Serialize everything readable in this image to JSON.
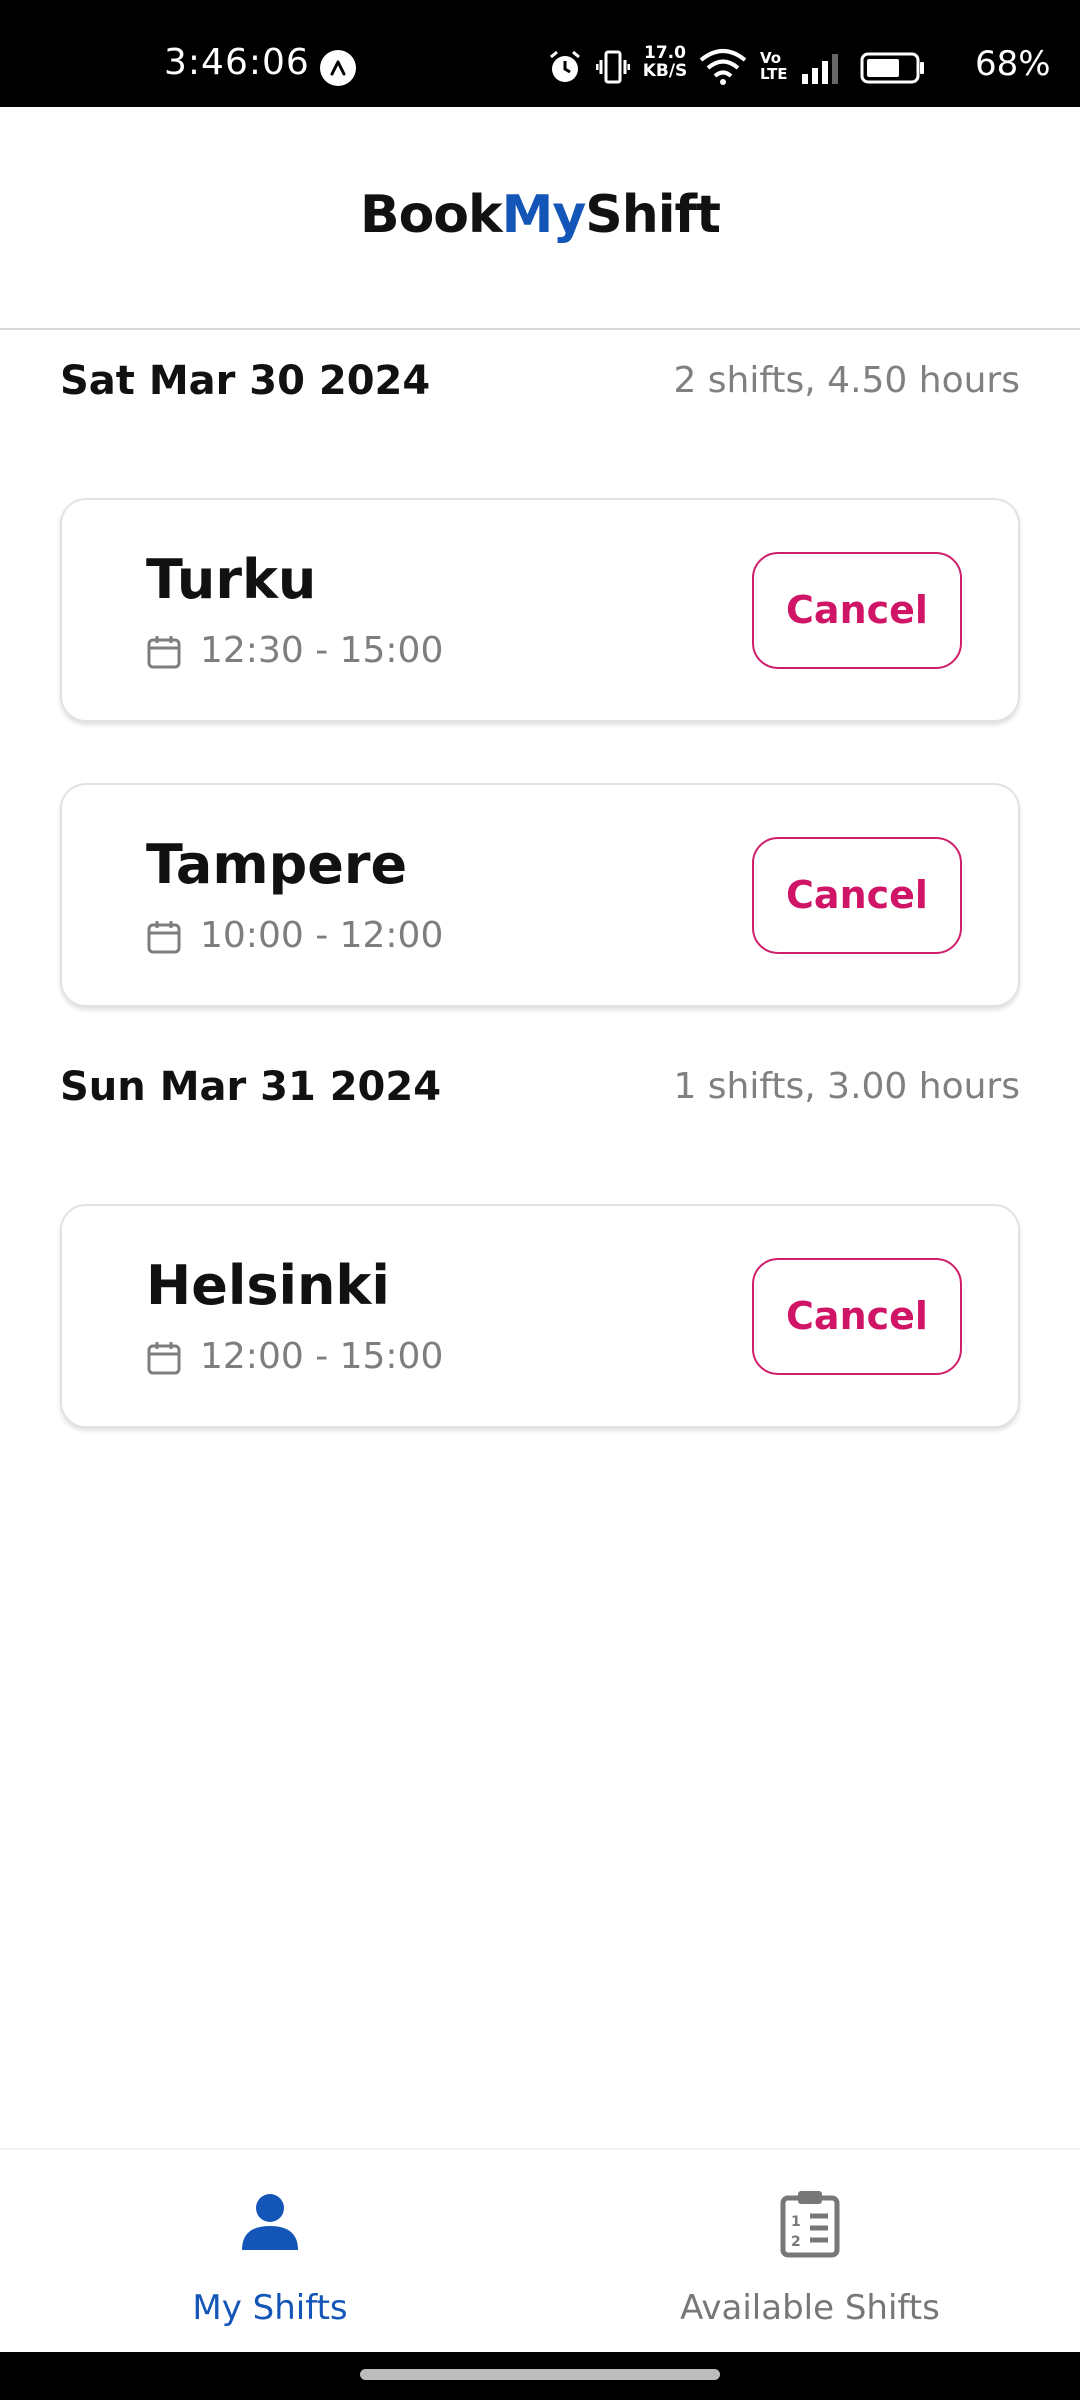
{
  "status_bar": {
    "time": "3:46:06",
    "net_speed_value": "17.0",
    "net_speed_unit": "KB/S",
    "volte_top": "Vo",
    "volte_bottom": "LTE",
    "battery": "68%",
    "icons": [
      "navigation-badge-icon",
      "alarm-icon",
      "vibrate-icon",
      "wifi-icon",
      "signal-icon",
      "battery-icon"
    ]
  },
  "header": {
    "brand_part1": "Book",
    "brand_part2": "My",
    "brand_part3": "Shift"
  },
  "days": [
    {
      "date": "Sat Mar 30 2024",
      "summary": "2 shifts, 4.50 hours",
      "shifts": [
        {
          "city": "Turku",
          "time": "12:30 - 15:00",
          "action": "Cancel"
        },
        {
          "city": "Tampere",
          "time": "10:00 - 12:00",
          "action": "Cancel"
        }
      ]
    },
    {
      "date": "Sun Mar 31 2024",
      "summary": "1 shifts, 3.00 hours",
      "shifts": [
        {
          "city": "Helsinki",
          "time": "12:00 - 15:00",
          "action": "Cancel"
        }
      ]
    }
  ],
  "bottom_nav": {
    "tabs": [
      {
        "label": "My Shifts",
        "icon": "person-icon",
        "active": true
      },
      {
        "label": "Available Shifts",
        "icon": "clipboard-list-icon",
        "active": false
      }
    ]
  },
  "colors": {
    "brand_blue": "#1456b8",
    "cancel_pink": "#d01466",
    "muted_text": "#808080"
  }
}
